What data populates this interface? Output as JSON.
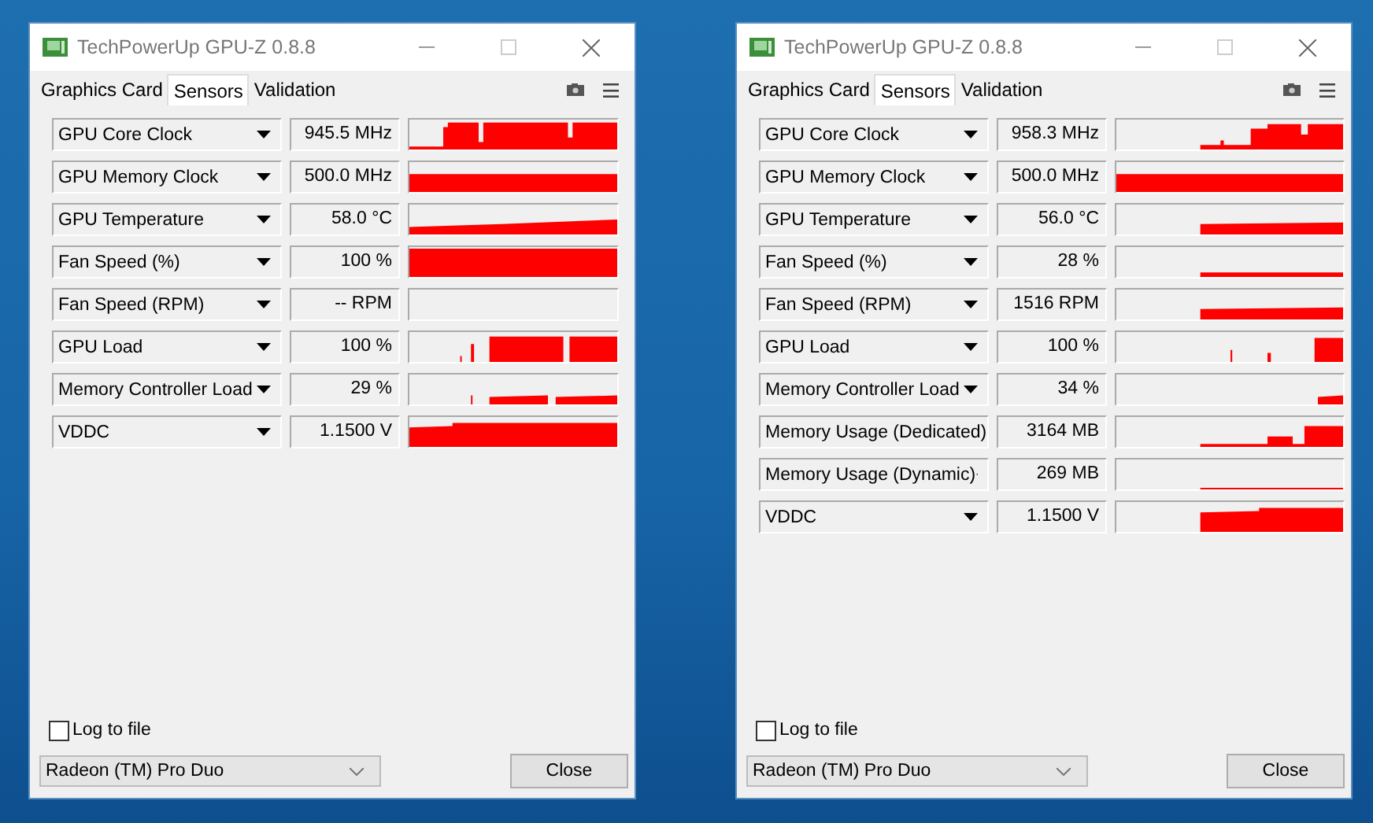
{
  "windows": [
    {
      "title": "TechPowerUp GPU-Z 0.8.8",
      "tabs": [
        {
          "label": "Graphics Card",
          "selected": false
        },
        {
          "label": "Sensors",
          "selected": true
        },
        {
          "label": "Validation",
          "selected": false
        }
      ],
      "sensors": [
        {
          "name": "GPU Core Clock",
          "value": "945.5 MHz"
        },
        {
          "name": "GPU Memory Clock",
          "value": "500.0 MHz"
        },
        {
          "name": "GPU Temperature",
          "value": "58.0 °C"
        },
        {
          "name": "Fan Speed (%)",
          "value": "100 %"
        },
        {
          "name": "Fan Speed (RPM)",
          "value": "-- RPM"
        },
        {
          "name": "GPU Load",
          "value": "100 %"
        },
        {
          "name": "Memory Controller Load",
          "value": "29 %"
        },
        {
          "name": "VDDC",
          "value": "1.1500 V"
        }
      ],
      "log_to_file": {
        "label": "Log to file",
        "checked": false
      },
      "gpu_select": {
        "value": "Radeon (TM) Pro Duo"
      },
      "close_button": "Close"
    },
    {
      "title": "TechPowerUp GPU-Z 0.8.8",
      "tabs": [
        {
          "label": "Graphics Card",
          "selected": false
        },
        {
          "label": "Sensors",
          "selected": true
        },
        {
          "label": "Validation",
          "selected": false
        }
      ],
      "sensors": [
        {
          "name": "GPU Core Clock",
          "value": "958.3 MHz"
        },
        {
          "name": "GPU Memory Clock",
          "value": "500.0 MHz"
        },
        {
          "name": "GPU Temperature",
          "value": "56.0 °C"
        },
        {
          "name": "Fan Speed (%)",
          "value": "28 %"
        },
        {
          "name": "Fan Speed (RPM)",
          "value": "1516 RPM"
        },
        {
          "name": "GPU Load",
          "value": "100 %"
        },
        {
          "name": "Memory Controller Load",
          "value": "34 %"
        },
        {
          "name": "Memory Usage (Dedicated)",
          "value": "3164 MB"
        },
        {
          "name": "Memory Usage (Dynamic)",
          "value": "269 MB"
        },
        {
          "name": "VDDC",
          "value": "1.1500 V"
        }
      ],
      "log_to_file": {
        "label": "Log to file",
        "checked": false
      },
      "gpu_select": {
        "value": "Radeon (TM) Pro Duo"
      },
      "close_button": "Close"
    }
  ]
}
